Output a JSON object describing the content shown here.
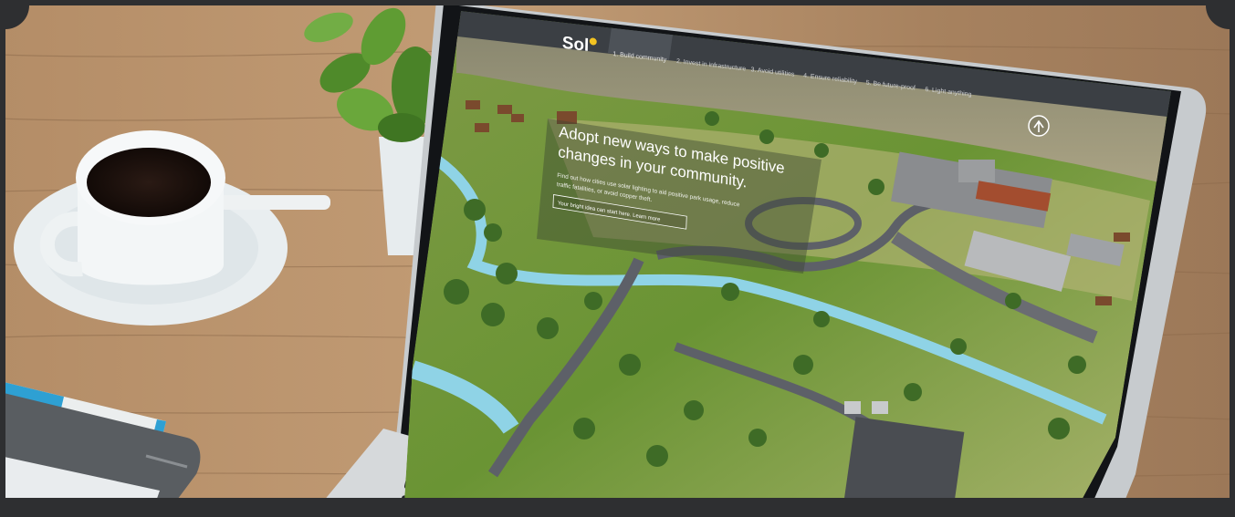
{
  "site": {
    "logo_text": "Sol",
    "nav": [
      {
        "label": "1. Build community"
      },
      {
        "label": "2. Invest in infrastructure"
      },
      {
        "label": "3. Avoid utilities"
      },
      {
        "label": "4. Ensure reliability"
      },
      {
        "label": "5. Be future-proof"
      },
      {
        "label": "6. Light anything"
      }
    ],
    "hero": {
      "headline_line1": "Adopt new ways to make positive",
      "headline_line2": "changes in your community.",
      "body_line1": "Find out how cities use solar lighting to aid positive park usage, reduce",
      "body_line2": "traffic fatalities, or avoid copper theft.",
      "cta": "Your bright idea can start here. Learn more"
    },
    "scroll_icon": "arrow-up-circle-icon"
  },
  "colors": {
    "nav_bar": "#3b3f44",
    "nav_active": "#4d5258",
    "logo_accent": "#f3c321",
    "grass": "#6f9a3a",
    "river": "#8fd3e6",
    "road": "#5d6068"
  }
}
